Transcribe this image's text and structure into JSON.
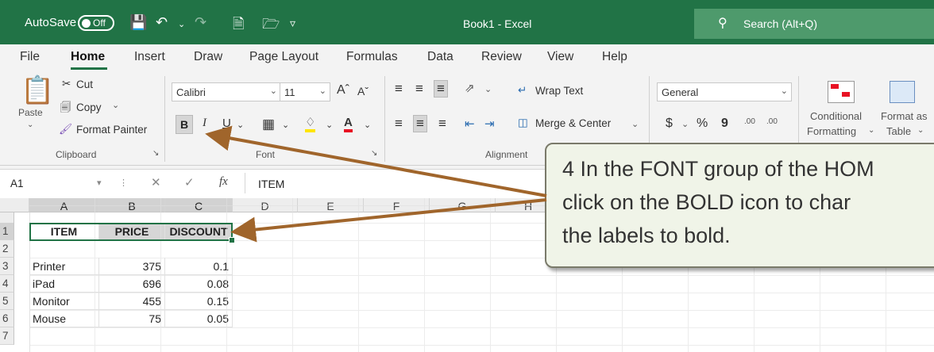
{
  "titlebar": {
    "autosave_label": "AutoSave",
    "autosave_state": "Off",
    "title": "Book1 - Excel",
    "search_placeholder": "Search (Alt+Q)"
  },
  "tabs": [
    "File",
    "Home",
    "Insert",
    "Draw",
    "Page Layout",
    "Formulas",
    "Data",
    "Review",
    "View",
    "Help"
  ],
  "active_tab": "Home",
  "clipboard": {
    "paste": "Paste",
    "cut": "Cut",
    "copy": "Copy",
    "format_painter": "Format Painter",
    "label": "Clipboard"
  },
  "font": {
    "name": "Calibri",
    "size": "11",
    "bold": "B",
    "italic": "I",
    "underline": "U",
    "label": "Font"
  },
  "alignment": {
    "wrap_text": "Wrap Text",
    "merge_center": "Merge & Center",
    "label": "Alignment"
  },
  "number": {
    "format": "General",
    "currency": "$",
    "percent": "%",
    "comma": "9",
    "inc_decimal": ".00",
    "dec_decimal": ".00"
  },
  "styles": {
    "conditional_1": "Conditional",
    "conditional_2": "Formatting",
    "format_as_1": "Format as",
    "format_as_2": "Table"
  },
  "formula_bar": {
    "name_box": "A1",
    "fx": "fx",
    "content": "ITEM"
  },
  "sheet": {
    "columns": [
      "A",
      "B",
      "C",
      "D",
      "E",
      "F",
      "G",
      "H"
    ],
    "rows": [
      "1",
      "2",
      "3",
      "4",
      "5",
      "6",
      "7"
    ],
    "headers": [
      "ITEM",
      "PRICE",
      "DISCOUNT"
    ],
    "data": [
      [
        "Printer",
        "375",
        "0.1"
      ],
      [
        "iPad",
        "696",
        "0.08"
      ],
      [
        "Monitor",
        "455",
        "0.15"
      ],
      [
        "Mouse",
        "75",
        "0.05"
      ]
    ]
  },
  "callout": {
    "line1": "4  In the FONT group of the HOM",
    "line2": "click on the BOLD icon to char",
    "line3": "the labels to bold."
  },
  "colors": {
    "excel_green": "#217346",
    "arrow": "#a0652b"
  }
}
